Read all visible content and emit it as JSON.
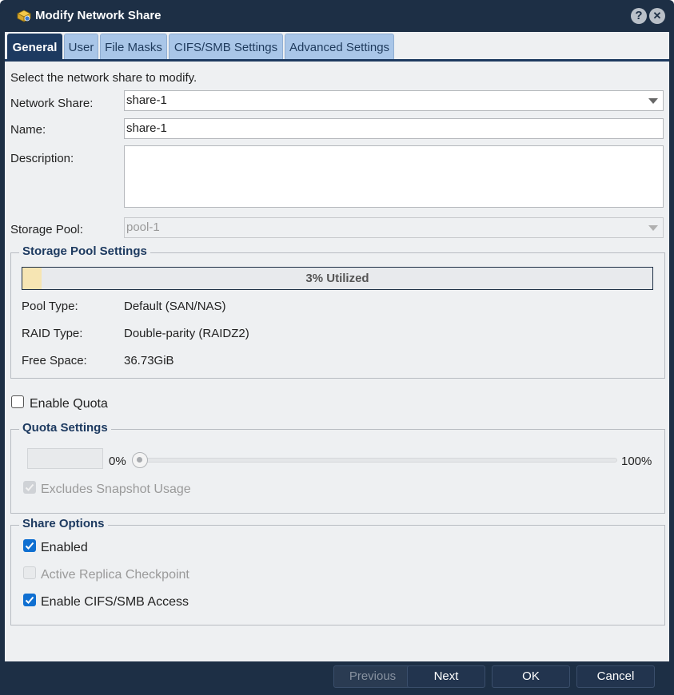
{
  "window": {
    "title": "Modify Network Share",
    "help_glyph": "?",
    "close_glyph": "✕"
  },
  "tabs": [
    {
      "label": "General",
      "active": true
    },
    {
      "label": "User",
      "active": false
    },
    {
      "label": "File Masks",
      "active": false
    },
    {
      "label": "CIFS/SMB Settings",
      "active": false
    },
    {
      "label": "Advanced Settings",
      "active": false
    }
  ],
  "general": {
    "instruction": "Select the network share to modify.",
    "network_share": {
      "label": "Network Share:",
      "value": "share-1"
    },
    "name": {
      "label": "Name:",
      "value": "share-1"
    },
    "description": {
      "label": "Description:",
      "value": ""
    },
    "storage_pool": {
      "label": "Storage Pool:",
      "value": "pool-1"
    }
  },
  "storage_pool_settings": {
    "legend": "Storage Pool Settings",
    "utilization": {
      "percent": 3,
      "text": "3% Utilized"
    },
    "pool_type": {
      "label": "Pool Type:",
      "value": "Default (SAN/NAS)"
    },
    "raid_type": {
      "label": "RAID Type:",
      "value": "Double-parity (RAIDZ2)"
    },
    "free_space": {
      "label": "Free Space:",
      "value": "36.73GiB"
    }
  },
  "enable_quota": {
    "label": "Enable Quota",
    "checked": false
  },
  "quota_settings": {
    "legend": "Quota Settings",
    "min_label": "0%",
    "max_label": "100%",
    "slider_value": 0,
    "excludes_snapshot": {
      "label": "Excludes Snapshot Usage",
      "checked": true,
      "disabled": true
    }
  },
  "share_options": {
    "legend": "Share Options",
    "enabled": {
      "label": "Enabled",
      "checked": true
    },
    "active_replica": {
      "label": "Active Replica Checkpoint",
      "checked": false,
      "disabled": true
    },
    "cifs_access": {
      "label": "Enable CIFS/SMB Access",
      "checked": true
    }
  },
  "footer": {
    "previous": "Previous",
    "next": "Next",
    "ok": "OK",
    "cancel": "Cancel"
  },
  "colors": {
    "titlebar": "#1d2f45",
    "tab_active": "#1d3a60",
    "tab_inactive": "#a9c6e8",
    "legend_text": "#1d3a60",
    "checkbox_checked": "#0f6fd1",
    "progress_fill": "#f6e5b3"
  }
}
